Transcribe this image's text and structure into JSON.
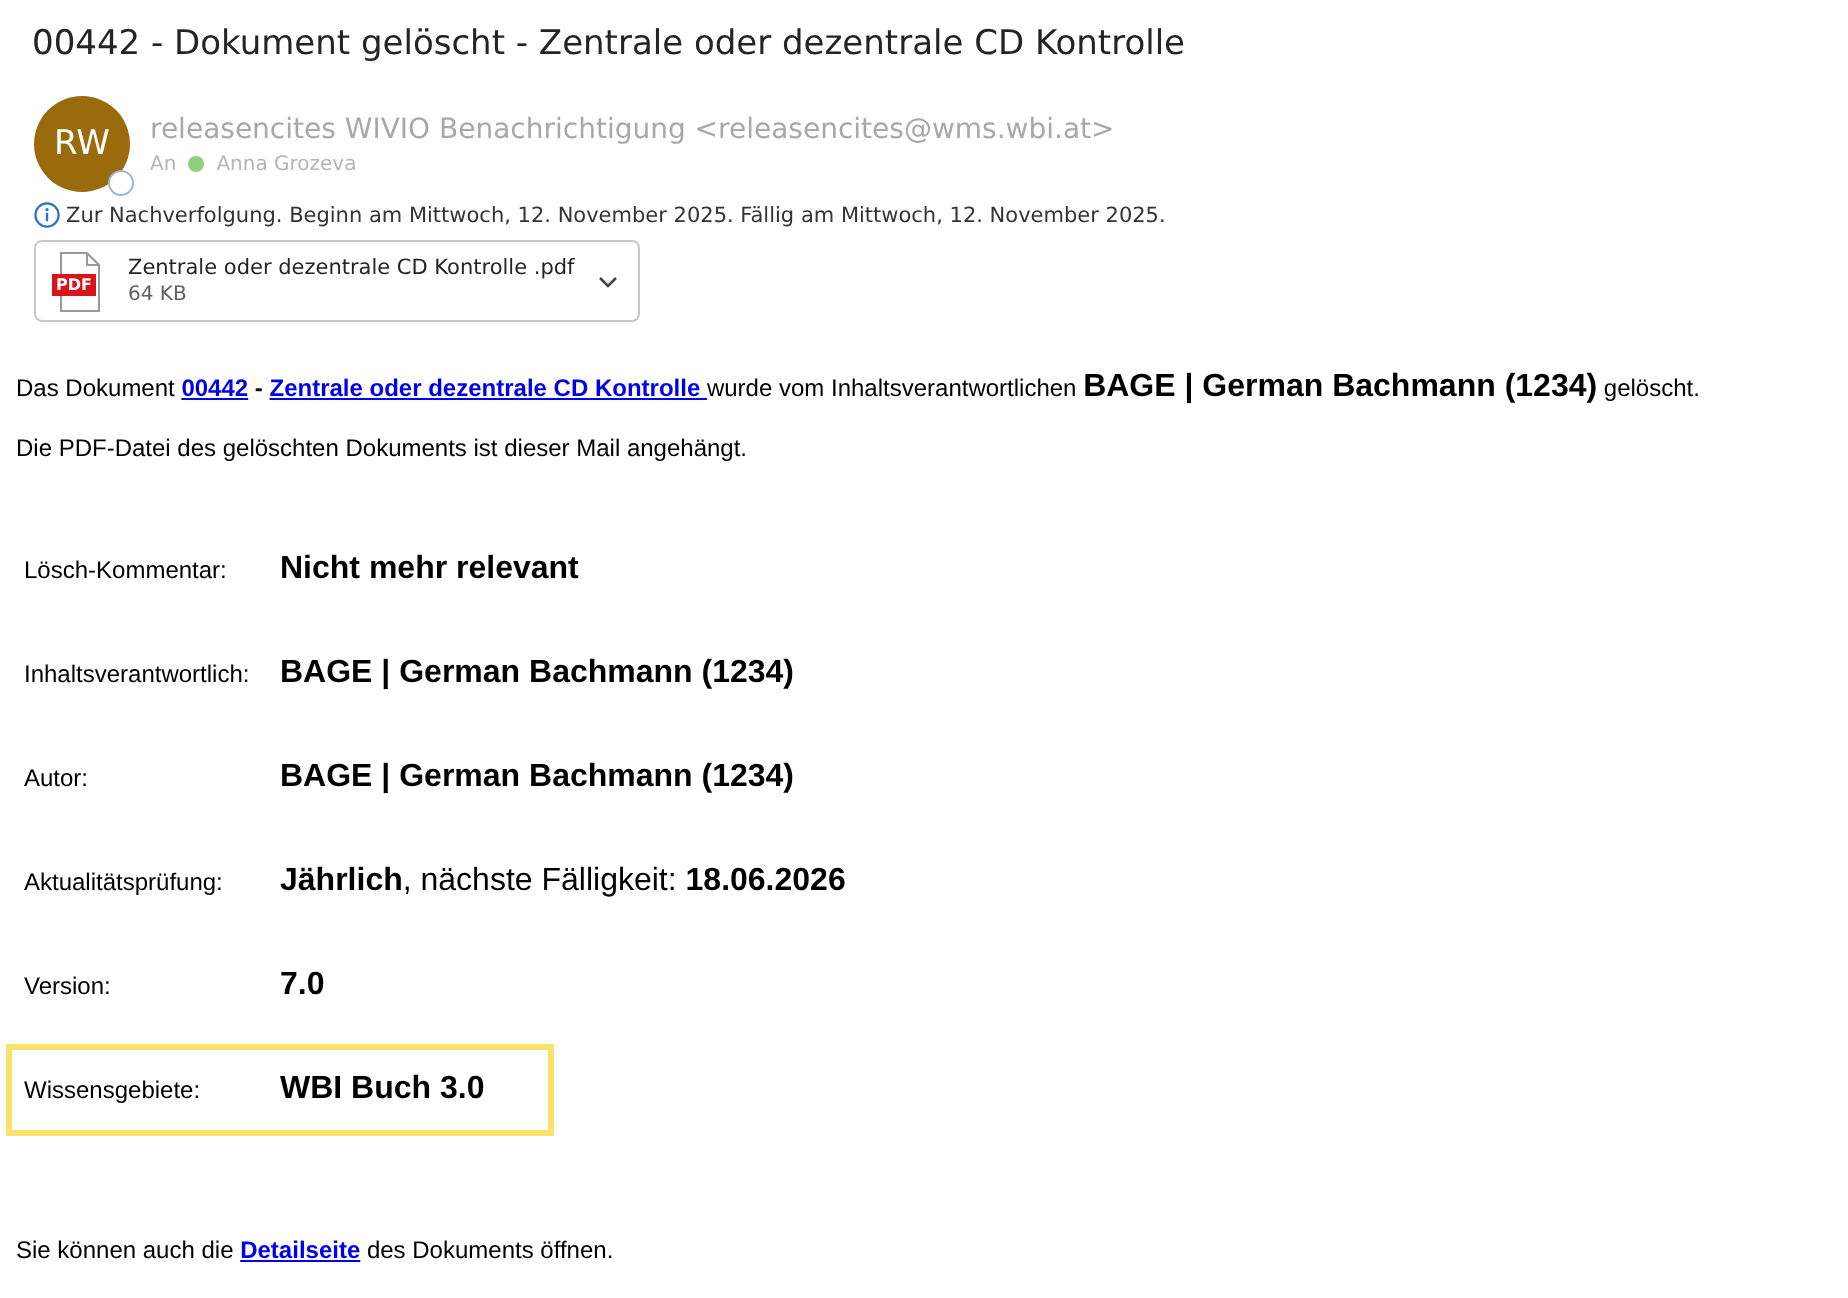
{
  "subject": "00442 - Dokument gelöscht - Zentrale oder dezentrale CD Kontrolle",
  "sender": {
    "initials": "RW",
    "name": "releasencites WIVIO Benachrichtigung <releasencites@wms.wbi.at>",
    "to_label": "An",
    "recipient": "Anna Grozeva",
    "presence_online": true
  },
  "info": "Zur Nachverfolgung.  Beginn am Mittwoch, 12. November 2025.  Fällig am Mittwoch, 12. November 2025.",
  "attachment": {
    "badge": "PDF",
    "name": "Zentrale oder dezentrale CD Kontrolle .pdf",
    "size": "64 KB"
  },
  "intro": [
    {
      "kind": "text",
      "text": "Das Dokument "
    },
    {
      "kind": "link",
      "text": "00442"
    },
    {
      "kind": "bold",
      "text": " - "
    },
    {
      "kind": "link",
      "text": "Zentrale oder dezentrale CD Kontrolle "
    },
    {
      "kind": "text",
      "text": "wurde vom Inhaltsverantwortlichen "
    },
    {
      "kind": "big",
      "text": "BAGE | German Bachmann (1234)"
    },
    {
      "kind": "text",
      "text": " gelöscht."
    }
  ],
  "attachment_note": "Die PDF-Datei des gelöschten Dokuments ist dieser Mail angehängt.",
  "fields": [
    {
      "label": "Lösch-Kommentar:",
      "value": "Nicht mehr relevant",
      "highlighted": false
    },
    {
      "label": "Inhaltsverantwortlich:",
      "value": "BAGE | German Bachmann (1234)",
      "highlighted": false
    },
    {
      "label": "Autor:",
      "value": "BAGE | German Bachmann (1234)",
      "highlighted": false
    },
    {
      "label": "Aktualitätsprüfung:",
      "value": "**Jährlich**, nächste Fälligkeit: **18.06.2026**",
      "highlighted": false
    },
    {
      "label": "Version:",
      "value": "7.0",
      "highlighted": false
    },
    {
      "label": "Wissensgebiete:",
      "value": "WBI Buch 3.0",
      "highlighted": true
    }
  ],
  "footer": [
    {
      "kind": "text",
      "text": "Sie können auch die "
    },
    {
      "kind": "link",
      "text": "Detailseite"
    },
    {
      "kind": "text",
      "text": " des Dokuments öffnen."
    }
  ]
}
